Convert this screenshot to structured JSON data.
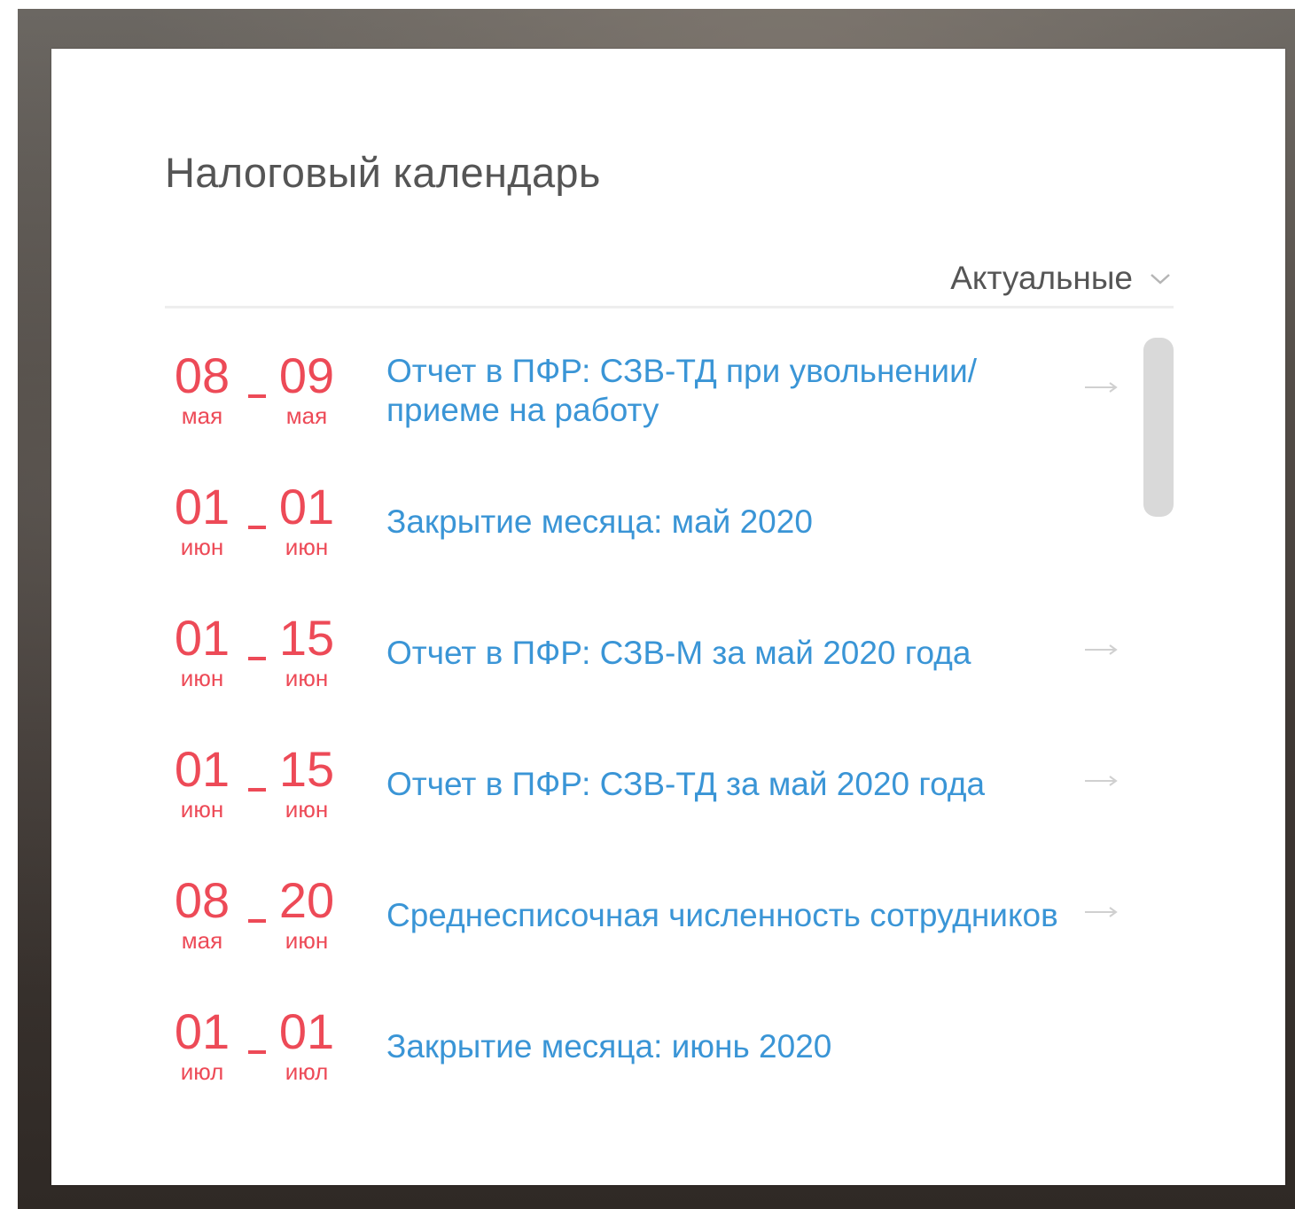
{
  "widget": {
    "title": "Налоговый календарь",
    "filter_label": "Актуальные",
    "filter_icon": "chevron-down-icon"
  },
  "colors": {
    "date": "#ed4a57",
    "link": "#3a95d6",
    "title": "#555555",
    "arrow": "#d0d0d0"
  },
  "events": [
    {
      "from_day": "08",
      "from_month": "мая",
      "to_day": "09",
      "to_month": "мая",
      "title": "Отчет в ПФР: СЗВ-ТД при увольнении/ приеме на работу",
      "has_arrow": true
    },
    {
      "from_day": "01",
      "from_month": "июн",
      "to_day": "01",
      "to_month": "июн",
      "title": "Закрытие месяца: май 2020",
      "has_arrow": false
    },
    {
      "from_day": "01",
      "from_month": "июн",
      "to_day": "15",
      "to_month": "июн",
      "title": "Отчет в ПФР: СЗВ-М за май 2020 года",
      "has_arrow": true
    },
    {
      "from_day": "01",
      "from_month": "июн",
      "to_day": "15",
      "to_month": "июн",
      "title": "Отчет в ПФР: СЗВ-ТД за май 2020 года",
      "has_arrow": true
    },
    {
      "from_day": "08",
      "from_month": "мая",
      "to_day": "20",
      "to_month": "июн",
      "title": "Среднесписочная численность сотрудников",
      "has_arrow": true
    },
    {
      "from_day": "01",
      "from_month": "июл",
      "to_day": "01",
      "to_month": "июл",
      "title": "Закрытие месяца: июнь 2020",
      "has_arrow": false
    }
  ]
}
